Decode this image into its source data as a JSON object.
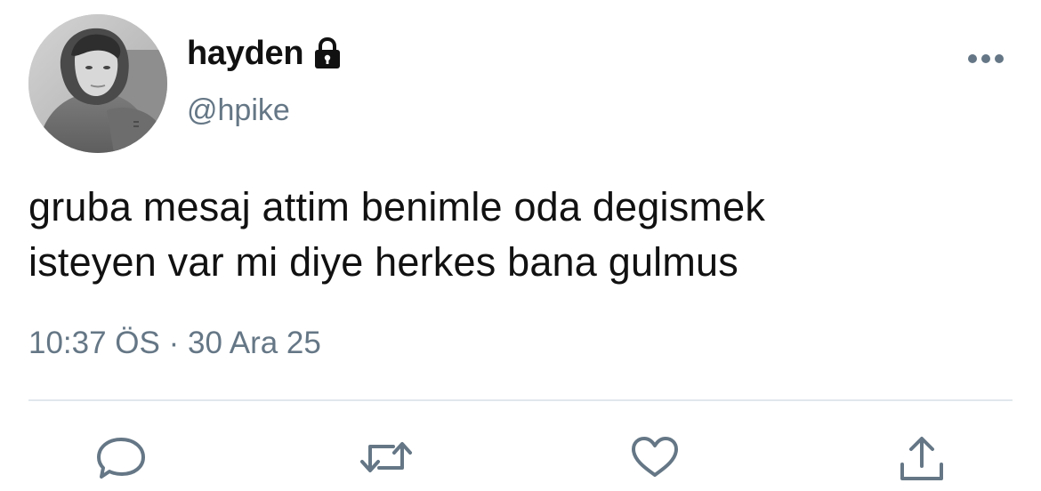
{
  "user": {
    "display_name": "hayden",
    "handle": "@hpike",
    "protected_icon": "lock-icon",
    "avatar": "profile-photo"
  },
  "tweet": {
    "text": "gruba mesaj attim benimle oda degismek\nisteyen var mi diye herkes bana gulmus",
    "time": "10:37 ÖS",
    "separator": "·",
    "date": "30 Ara 25"
  },
  "menu": {
    "icon": "more-horizontal-icon"
  },
  "actions": [
    {
      "name": "reply",
      "icon": "reply-icon"
    },
    {
      "name": "retweet",
      "icon": "retweet-icon"
    },
    {
      "name": "like",
      "icon": "heart-icon"
    },
    {
      "name": "share",
      "icon": "share-icon"
    }
  ],
  "colors": {
    "text_primary": "#111111",
    "text_secondary": "#657786",
    "divider": "#e1e8ed",
    "icon": "#657786"
  }
}
